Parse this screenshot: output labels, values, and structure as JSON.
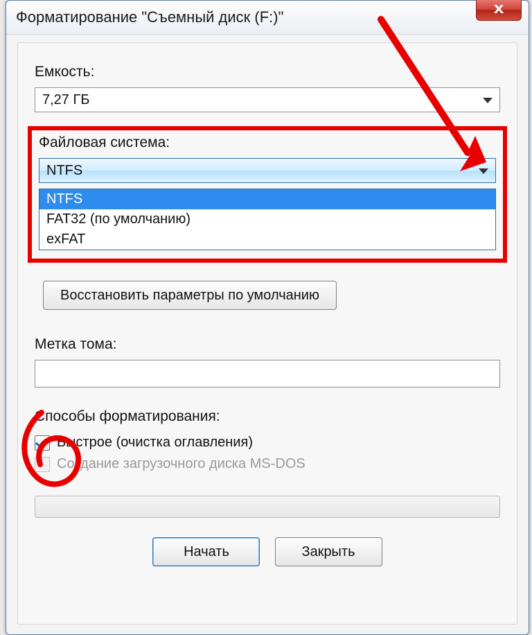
{
  "window": {
    "title": "Форматирование \"Съемный диск (F:)\"",
    "close_glyph": "x"
  },
  "capacity": {
    "label": "Емкость:",
    "value": "7,27 ГБ"
  },
  "filesystem": {
    "label": "Файловая система:",
    "value": "NTFS",
    "options": [
      "NTFS",
      "FAT32 (по умолчанию)",
      "exFAT"
    ]
  },
  "restore_defaults_label": "Восстановить параметры по умолчанию",
  "volume_label": {
    "label": "Метка тома:",
    "value": ""
  },
  "format_options": {
    "label": "Способы форматирования:",
    "quick_label": "Быстрое (очистка оглавления)",
    "quick_checked": true,
    "msdos_label": "Создание загрузочного диска MS-DOS",
    "msdos_checked": false
  },
  "buttons": {
    "start": "Начать",
    "close": "Закрыть"
  }
}
